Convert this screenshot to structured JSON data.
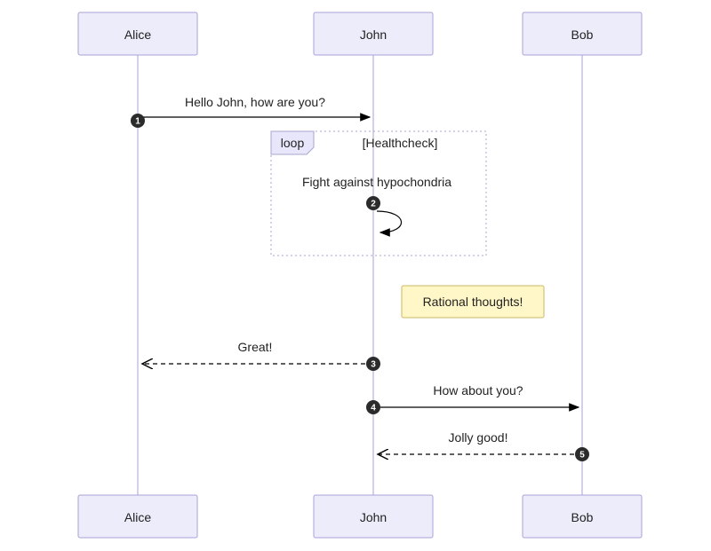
{
  "participants": {
    "alice": "Alice",
    "john": "John",
    "bob": "Bob"
  },
  "messages": {
    "m1": {
      "seq": "1",
      "text": "Hello John, how are you?"
    },
    "m2": {
      "seq": "2",
      "text": "Fight against hypochondria"
    },
    "m3": {
      "seq": "3",
      "text": "Great!"
    },
    "m4": {
      "seq": "4",
      "text": "How about you?"
    },
    "m5": {
      "seq": "5",
      "text": "Jolly good!"
    }
  },
  "loop": {
    "tag": "loop",
    "label": "[Healthcheck]"
  },
  "note": {
    "text": "Rational thoughts!"
  }
}
